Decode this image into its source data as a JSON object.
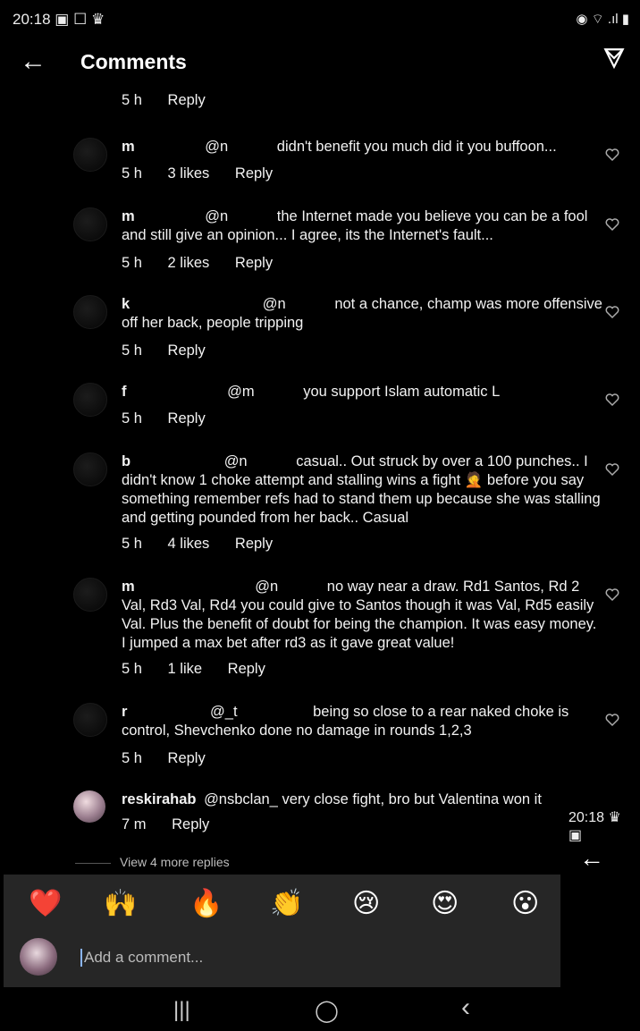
{
  "status": {
    "time": "20:18",
    "left_icons": "▣ ☐ ♛",
    "right_icons": "◉ ⌔ .ıl ▮"
  },
  "header": {
    "title": "Comments",
    "back": "←",
    "share_icon": "paper-plane-icon"
  },
  "comments": [
    {
      "user": "",
      "mention": "",
      "text": "",
      "time": "5 h",
      "likes": "",
      "reply": "Reply"
    },
    {
      "user": "m",
      "mention": "@n",
      "text": "didn't benefit you much did it you buffoon...",
      "time": "5 h",
      "likes": "3 likes",
      "reply": "Reply"
    },
    {
      "user": "m",
      "mention": "@n",
      "text": "the Internet made you believe you can be a fool and still give an opinion... I agree, its the Internet's fault...",
      "time": "5 h",
      "likes": "2 likes",
      "reply": "Reply"
    },
    {
      "user": "k",
      "mention": "@n",
      "text": "not a chance, champ was more offensive off her back, people tripping",
      "time": "5 h",
      "likes": "",
      "reply": "Reply"
    },
    {
      "user": "f",
      "mention": "@m",
      "text": "you support Islam automatic L",
      "time": "5 h",
      "likes": "",
      "reply": "Reply"
    },
    {
      "user": "b",
      "mention": "@n",
      "text": "casual.. Out struck by over a 100 punches.. I didn't know 1 choke attempt and stalling wins a fight 🤦 before you say something remember refs had to stand them up because she was stalling and getting pounded from her back.. Casual",
      "time": "5 h",
      "likes": "4 likes",
      "reply": "Reply"
    },
    {
      "user": "m",
      "mention": "@n",
      "text": "no way near a draw. Rd1 Santos, Rd 2 Val, Rd3 Val, Rd4 you could give to Santos though it was Val, Rd5 easily Val. Plus the benefit of doubt for being the champion. It was easy money. I jumped a max bet after rd3 as it gave great value!",
      "time": "5 h",
      "likes": "1 like",
      "reply": "Reply"
    },
    {
      "user": "r",
      "mention": "@_t",
      "text": "being so close to a rear naked choke is control, Shevchenko done no damage in rounds 1,2,3",
      "time": "5 h",
      "likes": "",
      "reply": "Reply"
    },
    {
      "user": "reskirahab",
      "mention": "@nsbclan_",
      "text": "very close fight, bro but Valentina won it",
      "time": "7 m",
      "likes": "",
      "reply": "Reply"
    }
  ],
  "view_more": "View 4 more replies",
  "emojis": [
    "❤️",
    "🙌",
    "🔥",
    "👏",
    "😢",
    "😍",
    "😮"
  ],
  "composer": {
    "placeholder": "Add a comment..."
  },
  "nav": {
    "recents": "|||",
    "home": "◯",
    "back": "‹"
  },
  "overlay": {
    "time": "20:18 ♛ ▣",
    "back": "←"
  }
}
